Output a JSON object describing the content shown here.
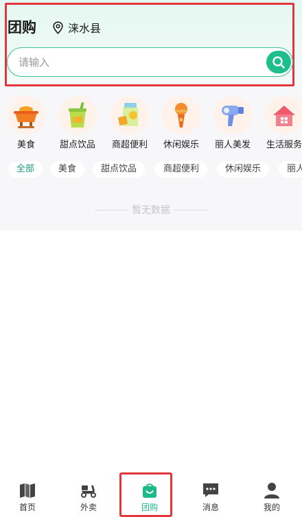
{
  "header": {
    "title": "团购",
    "location": "涞水县",
    "search_placeholder": "请输入"
  },
  "categories": [
    {
      "label": "美食",
      "icon": "hotpot-icon"
    },
    {
      "label": "甜点饮品",
      "icon": "drink-cup-icon"
    },
    {
      "label": "商超便利",
      "icon": "grocery-bag-icon"
    },
    {
      "label": "休闲娱乐",
      "icon": "microphone-icon"
    },
    {
      "label": "丽人美发",
      "icon": "hair-dryer-icon"
    },
    {
      "label": "生活服务",
      "icon": "house-icon"
    }
  ],
  "filter_chips": [
    "全部",
    "美食",
    "甜点饮品",
    "商超便利",
    "休闲娱乐",
    "丽人美发"
  ],
  "empty_text": "暂无数据",
  "tabbar": [
    {
      "label": "首页",
      "icon": "home-map-icon"
    },
    {
      "label": "外卖",
      "icon": "scooter-icon"
    },
    {
      "label": "团购",
      "icon": "shopping-bag-icon"
    },
    {
      "label": "消息",
      "icon": "message-icon"
    },
    {
      "label": "我的",
      "icon": "user-icon"
    }
  ],
  "colors": {
    "accent": "#1cbf8a",
    "highlight_border": "#e2353c"
  }
}
